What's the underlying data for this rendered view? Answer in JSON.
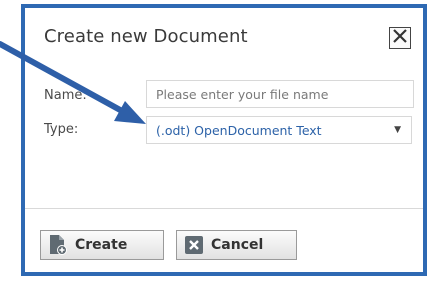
{
  "dialog": {
    "title": "Create new Document",
    "close_label": "X"
  },
  "form": {
    "name_label": "Name:",
    "name_placeholder": "Please enter your file name",
    "name_value": "",
    "type_label": "Type:",
    "type_selected": "(.odt) OpenDocument Text"
  },
  "footer": {
    "create_label": "Create",
    "cancel_label": "Cancel"
  },
  "icons": {
    "close": "close-icon",
    "caret": "chevron-down-icon",
    "create": "document-add-icon",
    "cancel": "cancel-x-icon",
    "annotation": "arrow-pointer-icon"
  },
  "colors": {
    "border_accent": "#2e69b3",
    "select_text": "#2c62a8",
    "annotation_arrow": "#2e5fa8"
  }
}
